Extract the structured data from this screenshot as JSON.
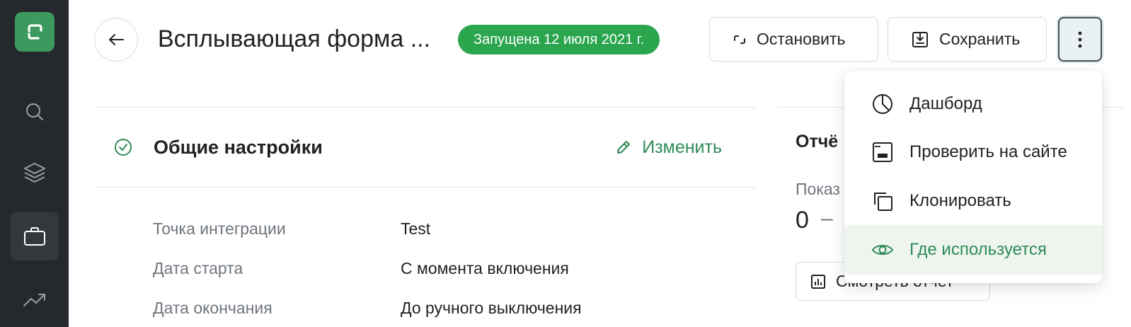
{
  "header": {
    "title": "Всплывающая форма ...",
    "status_badge": "Запущена 12 июля 2021 г.",
    "stop_label": "Остановить",
    "save_label": "Сохранить"
  },
  "sidebar": {
    "items": [
      {
        "icon": "search-icon"
      },
      {
        "icon": "layers-icon"
      },
      {
        "icon": "briefcase-icon",
        "active": true
      },
      {
        "icon": "trending-up-icon"
      }
    ]
  },
  "general_settings": {
    "title": "Общие настройки",
    "edit_label": "Изменить",
    "properties": [
      {
        "label": "Точка интеграции",
        "value": "Test"
      },
      {
        "label": "Дата старта",
        "value": "С момента включения"
      },
      {
        "label": "Дата окончания",
        "value": "До ручного выключения"
      }
    ]
  },
  "report": {
    "title": "Отчё",
    "label": "Показ",
    "value": "0",
    "dash": "–",
    "button_label": "Смотреть отчет"
  },
  "dropdown": {
    "items": [
      {
        "label": "Дашборд",
        "icon": "pie-chart-icon"
      },
      {
        "label": "Проверить на сайте",
        "icon": "browser-window-icon"
      },
      {
        "label": "Клонировать",
        "icon": "copy-icon"
      },
      {
        "label": "Где используется",
        "icon": "eye-icon",
        "highlighted": true
      }
    ]
  },
  "colors": {
    "accent": "#2ba64f",
    "link_green": "#2e8b57",
    "sidebar": "#25282c"
  }
}
